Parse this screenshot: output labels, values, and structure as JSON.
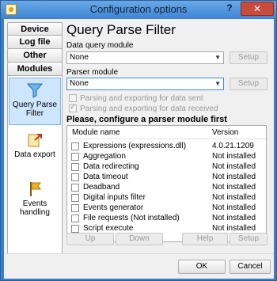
{
  "window": {
    "title": "Configuration options",
    "help_label": "?",
    "close_label": "✕"
  },
  "nav": {
    "device": "Device",
    "log_file": "Log file",
    "other": "Other",
    "modules": "Modules",
    "items": [
      {
        "label": "Query Parse Filter",
        "icon": "funnel-icon"
      },
      {
        "label": "Data export",
        "icon": "export-icon"
      },
      {
        "label": "Events handling",
        "icon": "flag-icon"
      }
    ]
  },
  "main": {
    "heading": "Query Parse Filter",
    "data_query_label": "Data query module",
    "data_query_value": "None",
    "parser_label": "Parser module",
    "parser_value": "None",
    "setup_label": "Setup",
    "parse_sent_label": "Parsing and exporting for data sent",
    "parse_received_label": "Parsing and exporting for data received",
    "warning": "Please, configure a parser module first",
    "list": {
      "col_name": "Module name",
      "col_version": "Version",
      "rows": [
        {
          "name": "Expressions (expressions.dll)",
          "version": "4.0.21.1209"
        },
        {
          "name": "Aggregation",
          "version": "Not installed"
        },
        {
          "name": "Data redirecting",
          "version": "Not installed"
        },
        {
          "name": "Data timeout",
          "version": "Not installed"
        },
        {
          "name": "Deadband",
          "version": "Not installed"
        },
        {
          "name": "Digital inputs filter",
          "version": "Not installed"
        },
        {
          "name": "Events generator",
          "version": "Not installed"
        },
        {
          "name": "File requests (Not installed)",
          "version": "Not installed"
        },
        {
          "name": "Script execute",
          "version": "Not installed"
        }
      ]
    },
    "up_label": "Up",
    "down_label": "Down",
    "help_label": "Help",
    "setup2_label": "Setup"
  },
  "footer": {
    "ok_label": "OK",
    "cancel_label": "Cancel"
  }
}
